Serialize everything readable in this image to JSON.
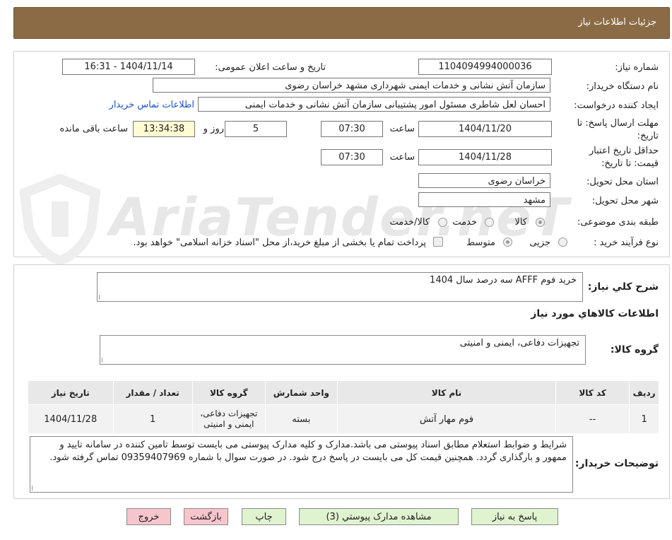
{
  "header": {
    "title": "جزئيات اطلاعات نیاز"
  },
  "watermark": {
    "text": "AriaTender.neT"
  },
  "form": {
    "need_number_label": "شماره نیاز:",
    "need_number": "1104094994000036",
    "announce_label": "تاریخ و ساعت اعلان عمومی:",
    "announce_value": "1404/11/14 - 16:31",
    "buyer_label": "نام دستگاه خریدار:",
    "buyer_value": "سازمان آتش نشانی و خدمات ایمنی شهرداری مشهد خراسان رضوی",
    "creator_label": "ایجاد کننده درخواست:",
    "creator_value": "احسان لعل شاطری مسئول امور پشتیبانی سازمان آتش نشانی و خدمات ایمنی",
    "contact_link": "اطلاعات تماس خریدار",
    "deadline_label_1": "مهلت ارسال پاسخ: تا",
    "deadline_label_2": "تاریخ:",
    "deadline_date": "1404/11/20",
    "time_label": "ساعت",
    "deadline_time": "07:30",
    "days_value": "5",
    "days_label": "روز و",
    "remaining_time": "13:34:38",
    "remaining_label": "ساعت باقی مانده",
    "validity_label_1": "حداقل تاریخ اعتبار",
    "validity_label_2": "قیمت: تا تاریخ:",
    "validity_date": "1404/11/28",
    "validity_time": "07:30",
    "province_label": "استان محل تحویل:",
    "province_value": "خراسان رضوی",
    "city_label": "شهر محل تحویل:",
    "city_value": "مشهد",
    "category_label": "طبقه بندی موضوعی:",
    "category_options": [
      "کالا",
      "خدمت",
      "کالا/خدمت"
    ],
    "category_selected": "کالا",
    "process_label": "نوع فرآیند خرید :",
    "process_options": [
      "جزیی",
      "متوسط"
    ],
    "process_selected": "متوسط",
    "payment_note": "پرداخت تمام یا بخشی از مبلغ خرید،از محل \"اسناد خزانه اسلامی\" خواهد بود."
  },
  "summary": {
    "description_label": "شرح کلي نياز:",
    "description_value": "خرید فوم AFFF سه درصد سال 1404",
    "goods_info_title": "اطلاعات کالاهاي مورد نياز",
    "goods_group_label": "گروه کالا:",
    "goods_group_value": "تجهیزات دفاعی، ایمنی و امنیتی"
  },
  "table": {
    "headers": [
      "رديف",
      "کد کالا",
      "نام کالا",
      "واحد شمارش",
      "گروه کالا",
      "تعداد / مقدار",
      "تاریخ نیاز"
    ],
    "rows": [
      [
        "1",
        "--",
        "فوم مهار آتش",
        "بسته",
        "تجهیزات دفاعی، ایمنی و امنیتی",
        "1",
        "1404/11/28"
      ]
    ]
  },
  "buyer_notes": {
    "label": "توضیحات خریدار:",
    "text": "شرایط و ضوابط استعلام مطابق اسناد پیوستی می باشد.مدارک و کلیه مدارک پیوستی می بایست توسط تامین کننده در سامانه تایید و ممهور و بارگذاری گردد. همچنین قیمت کل می بایست در پاسخ درج شود. در صورت سوال با شماره 09359407969 تماس گرفته شود."
  },
  "buttons": {
    "reply": "پاسخ به نیاز",
    "view_docs": "مشاهده مدارک پیوستي (3)",
    "print": "چاپ",
    "back": "بازگشت",
    "exit": "خروج"
  }
}
